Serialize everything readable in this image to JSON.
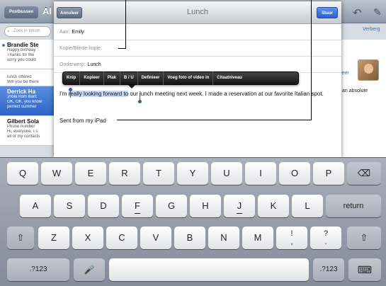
{
  "mailbox": {
    "back_label": "Postbussen",
    "title": "Al",
    "search_placeholder": "Zoek in Inkom",
    "edit_label": "Verberg",
    "messages": [
      {
        "from": "Brandie Ste",
        "lines": [
          "Happy birthday",
          "Thanks for the",
          "sorry you could"
        ]
      },
      {
        "from": "",
        "lines": [
          "lunch offered",
          "Will you be there"
        ]
      },
      {
        "from": "Derrick Ha",
        "lines": [
          "¡Hola from Barc",
          "OK, OK, you know",
          "perfect summer"
        ]
      },
      {
        "from": "Gilbert Sola",
        "lines": [
          "Phone number",
          "Hi, everyone. I s",
          "all of my contacts"
        ]
      }
    ],
    "right_link": "ieer",
    "right_text": "an absolute"
  },
  "compose": {
    "cancel_label": "Annuleer",
    "title": "Lunch",
    "send_label": "Stuur",
    "to_label": "Aan:",
    "to_value": "Emily",
    "cc_label": "Kopie/Blinde kopie:",
    "subject_label": "Onderwerp:",
    "subject_value": "Lunch",
    "body_before": "I'm ",
    "body_selected": "really looking forward to",
    "body_after": " our lunch meeting next week. I made a reservation at our favorite Italian spot.",
    "signature": "Sent from my iPad"
  },
  "edit_menu": [
    "Knip",
    "Kopieer",
    "Plak",
    "B / U",
    "Definieer",
    "Voeg foto of video in",
    "Citaatniveau"
  ],
  "keyboard": {
    "row1": [
      "Q",
      "W",
      "E",
      "R",
      "T",
      "Y",
      "U",
      "I",
      "O",
      "P"
    ],
    "row2": [
      "A",
      "S",
      "D",
      "F",
      "G",
      "H",
      "J",
      "K",
      "L"
    ],
    "row3": [
      "Z",
      "X",
      "C",
      "V",
      "B",
      "N",
      "M"
    ],
    "excl": [
      "!",
      ","
    ],
    "question": [
      "?",
      "."
    ],
    "return_label": "return",
    "numbers_label": ".?123",
    "backspace_icon": "⌫",
    "shift_icon": "⇧",
    "mic_icon": "🎤",
    "hide_icon": "⌨"
  }
}
